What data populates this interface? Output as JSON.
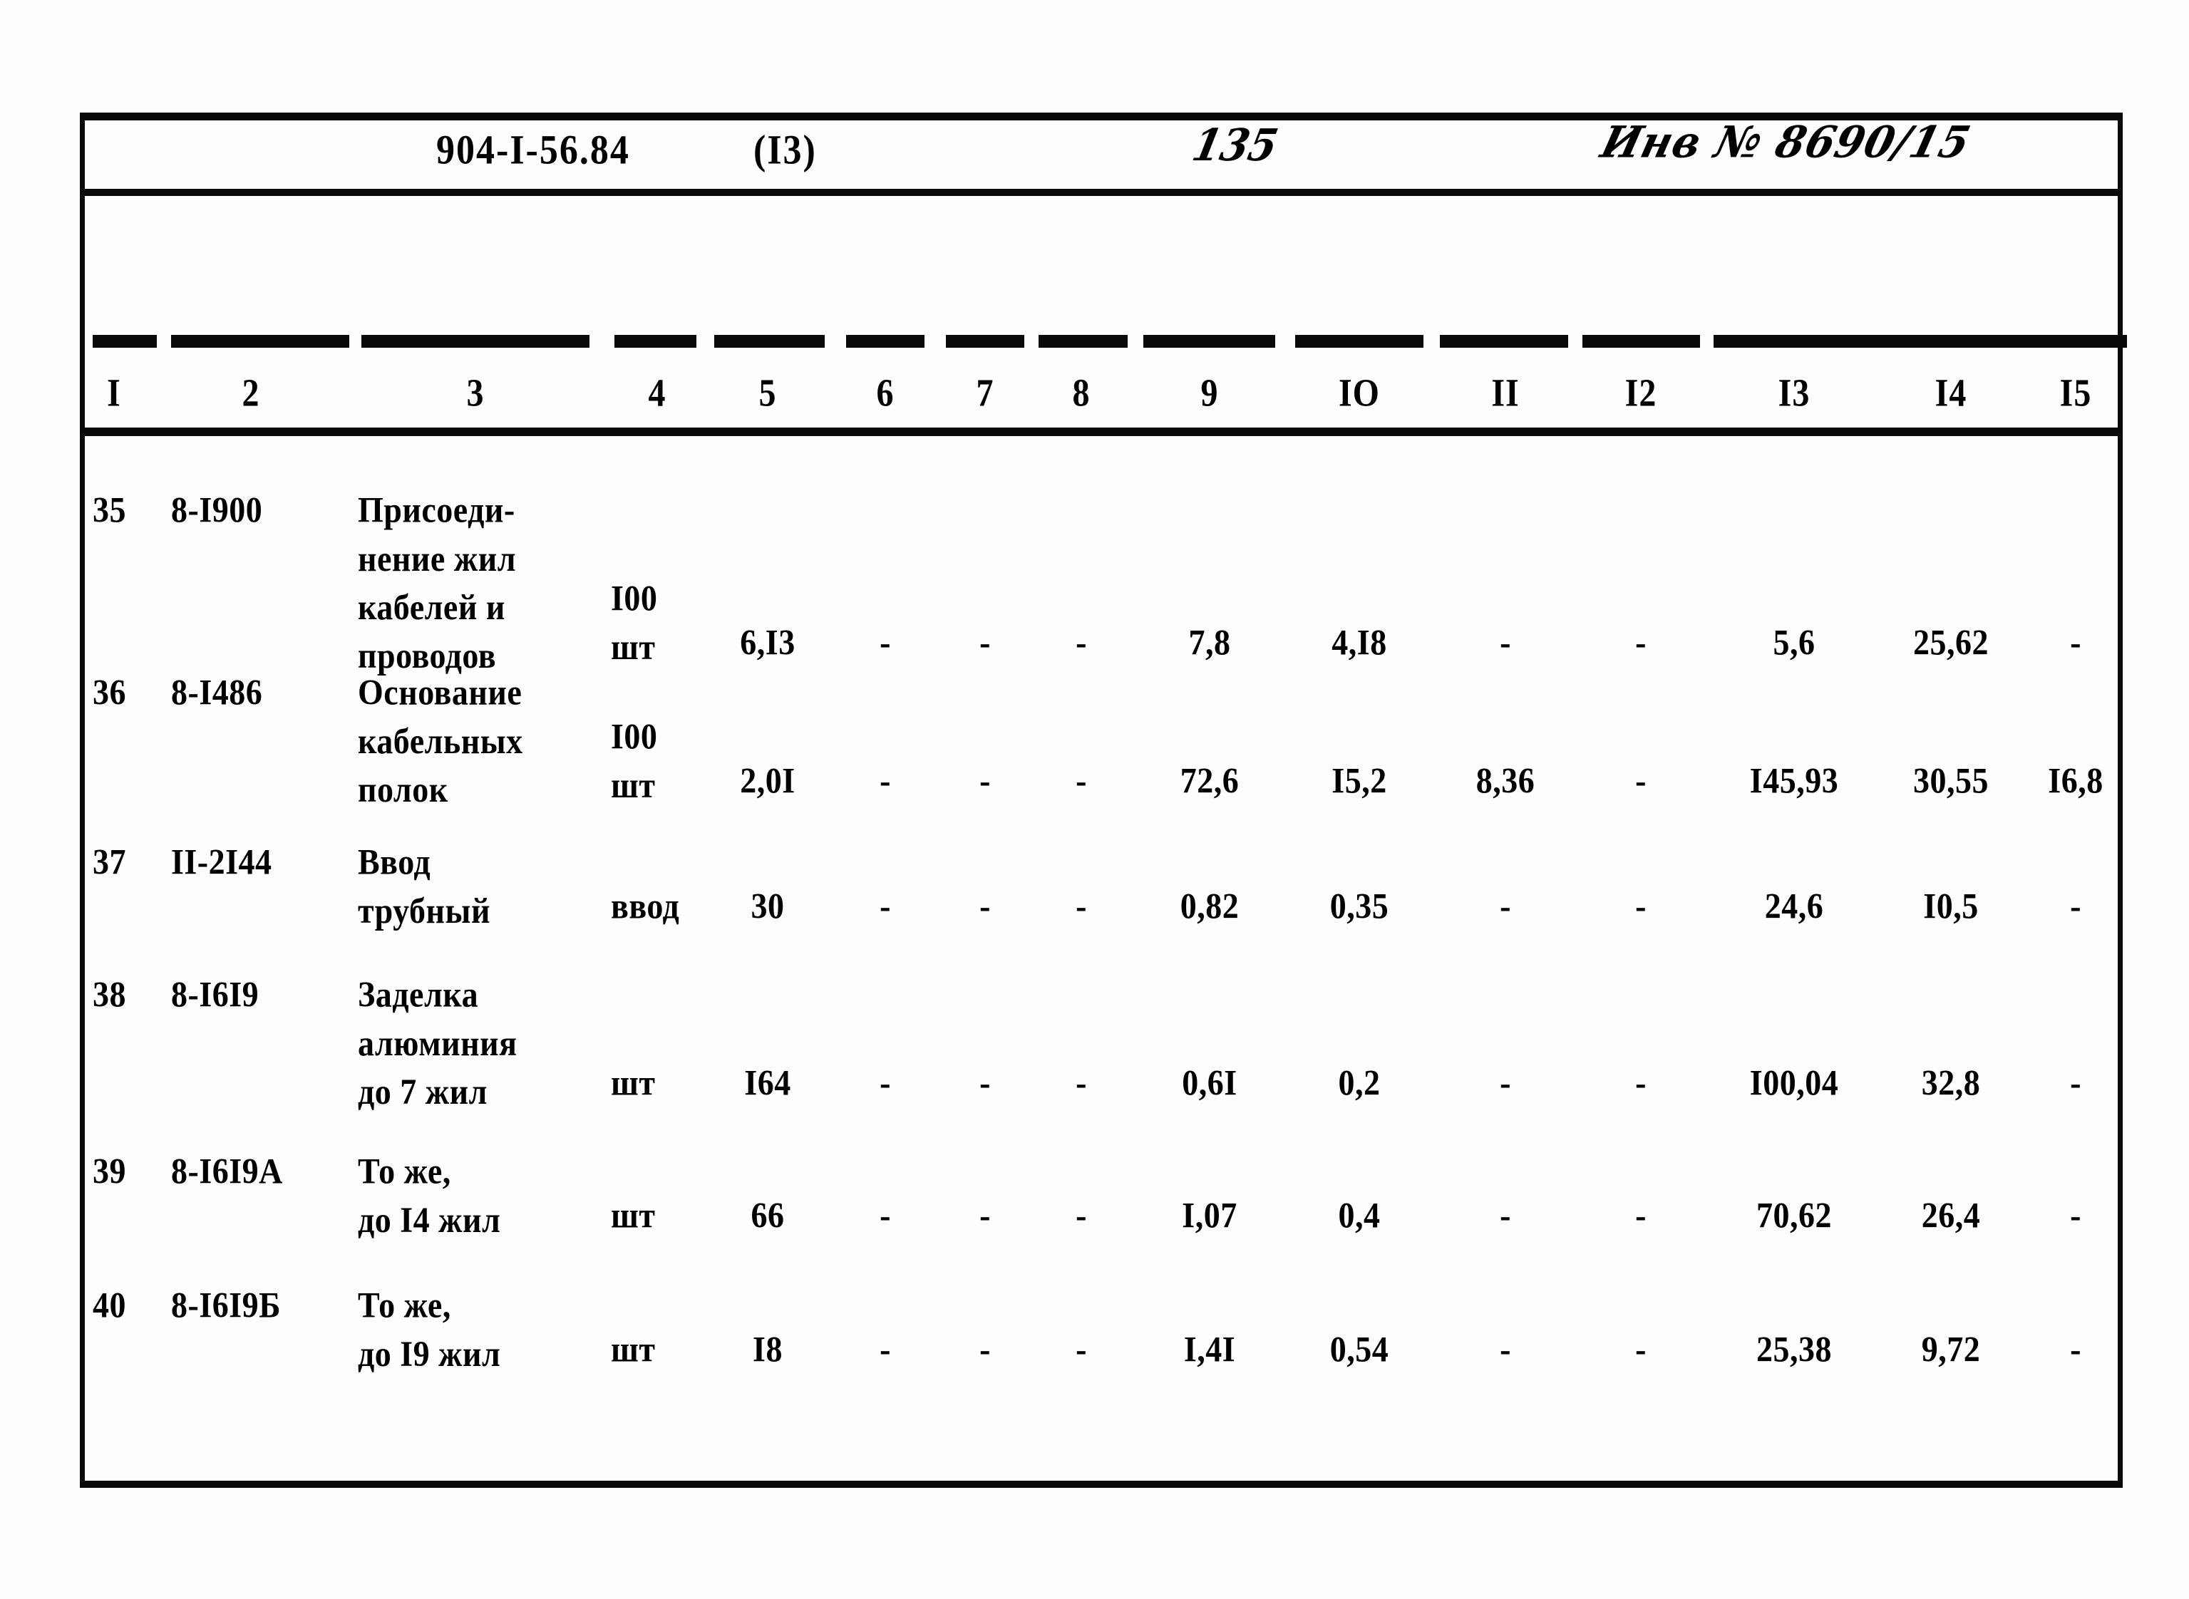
{
  "header": {
    "doc_code": "904-I-56.84",
    "variant": "(I3)",
    "page_number": "135",
    "inventory_number": "Инв № 8690/15"
  },
  "table": {
    "column_numbers": [
      "I",
      "2",
      "3",
      "4",
      "5",
      "6",
      "7",
      "8",
      "9",
      "IO",
      "II",
      "I2",
      "I3",
      "I4",
      "I5"
    ],
    "rows": [
      {
        "c1": "35",
        "c2": "8-I900",
        "c3": "Присоеди-\nнение жил\nкабелей и\nпроводов",
        "c4": "I00\nшт",
        "c5": "6,I3",
        "c6": "-",
        "c7": "-",
        "c8": "-",
        "c9": "7,8",
        "c10": "4,I8",
        "c11": "-",
        "c12": "-",
        "c13": "5,6",
        "c14": "25,62",
        "c15": "-"
      },
      {
        "c1": "36",
        "c2": "8-I486",
        "c3": "Основание\nкабельных\nполок",
        "c4": "I00\nшт",
        "c5": "2,0I",
        "c6": "-",
        "c7": "-",
        "c8": "-",
        "c9": "72,6",
        "c10": "I5,2",
        "c11": "8,36",
        "c12": "-",
        "c13": "I45,93",
        "c14": "30,55",
        "c15": "I6,8"
      },
      {
        "c1": "37",
        "c2": "II-2I44",
        "c3": "Ввод\nтрубный",
        "c4": "ввод",
        "c5": "30",
        "c6": "-",
        "c7": "-",
        "c8": "-",
        "c9": "0,82",
        "c10": "0,35",
        "c11": "-",
        "c12": "-",
        "c13": "24,6",
        "c14": "I0,5",
        "c15": "-"
      },
      {
        "c1": "38",
        "c2": "8-I6I9",
        "c3": "Заделка\nалюминия\nдо 7 жил",
        "c4": "шт",
        "c5": "I64",
        "c6": "-",
        "c7": "-",
        "c8": "-",
        "c9": "0,6I",
        "c10": "0,2",
        "c11": "-",
        "c12": "-",
        "c13": "I00,04",
        "c14": "32,8",
        "c15": "-"
      },
      {
        "c1": "39",
        "c2": "8-I6I9А",
        "c3": "То же,\nдо I4 жил",
        "c4": "шт",
        "c5": "66",
        "c6": "-",
        "c7": "-",
        "c8": "-",
        "c9": "I,07",
        "c10": "0,4",
        "c11": "-",
        "c12": "-",
        "c13": "70,62",
        "c14": "26,4",
        "c15": "-"
      },
      {
        "c1": "40",
        "c2": "8-I6I9Б",
        "c3": "То же,\nдо I9 жил",
        "c4": "шт",
        "c5": "I8",
        "c6": "-",
        "c7": "-",
        "c8": "-",
        "c9": "I,4I",
        "c10": "0,54",
        "c11": "-",
        "c12": "-",
        "c13": "25,38",
        "c14": "9,72",
        "c15": "-"
      }
    ]
  }
}
